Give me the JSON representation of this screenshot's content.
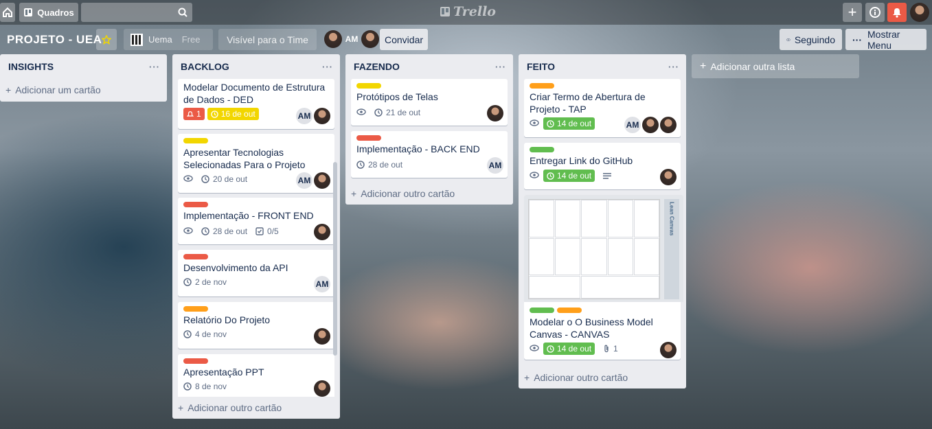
{
  "topbar": {
    "boards_label": "Quadros",
    "logo_text": "Trello"
  },
  "board": {
    "title": "PROJETO - UEA",
    "team": "Uema",
    "plan": "Free",
    "visibility": "Visível para o Time",
    "member_initials": "AM",
    "invite": "Convidar",
    "following": "Seguindo",
    "show_menu": "Mostrar Menu"
  },
  "colors": {
    "green": "#61bd4f",
    "yellow": "#f2d600",
    "orange": "#ff9f1a",
    "red": "#eb5a46",
    "due_green": "#61bd4f",
    "due_yellow": "#f2d600"
  },
  "lists": [
    {
      "name": "INSIGHTS",
      "add": "Adicionar um cartão"
    },
    {
      "name": "BACKLOG",
      "add": "Adicionar outro cartão",
      "cards": [
        {
          "title": "Modelar Documento de Estrutura de Dados - DED",
          "notif": "1",
          "due": "16 de out"
        },
        {
          "title": "Apresentar Tecnologias Selecionadas Para o Projeto",
          "due": "20 de out"
        },
        {
          "title": "Implementação - FRONT END",
          "due": "28 de out",
          "checklist": "0/5"
        },
        {
          "title": "Desenvolvimento da API",
          "due": "2 de nov"
        },
        {
          "title": "Relatório Do Projeto",
          "due": "4 de nov"
        },
        {
          "title": "Apresentação PPT",
          "due": "8 de nov"
        }
      ]
    },
    {
      "name": "FAZENDO",
      "add": "Adicionar outro cartão",
      "cards": [
        {
          "title": "Protótipos de Telas",
          "due": "21 de out"
        },
        {
          "title": "Implementação - BACK END",
          "due": "28 de out"
        }
      ]
    },
    {
      "name": "FEITO",
      "add": "Adicionar outro cartão",
      "cards": [
        {
          "title": "Criar Termo de Abertura de Projeto - TAP",
          "due": "14 de out"
        },
        {
          "title": "Entregar Link do GitHub",
          "due": "14 de out"
        },
        {
          "title": "Modelar o O Business Model Canvas - CANVAS",
          "due": "14 de out",
          "attachments": "1",
          "cover_title": "Lean Canvas"
        }
      ]
    }
  ],
  "add_list": "Adicionar outra lista"
}
